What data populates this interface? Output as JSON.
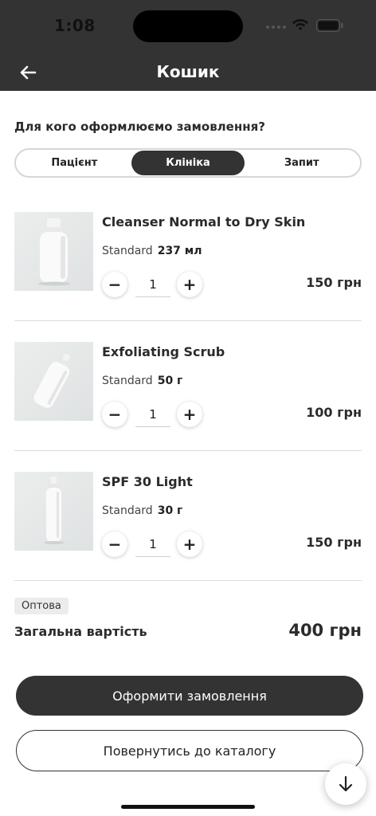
{
  "status_bar": {
    "time": "1:08"
  },
  "header": {
    "title": "Кошик"
  },
  "recipient": {
    "question": "Для кого оформлюємо замовлення?",
    "options": [
      "Пацієнт",
      "Клініка",
      "Запит"
    ],
    "selected": "Клініка"
  },
  "cart": {
    "items": [
      {
        "name": "Cleanser Normal to Dry Skin",
        "variant_label": "Standard",
        "size": "237 мл",
        "quantity": "1",
        "price": "150 грн"
      },
      {
        "name": "Exfoliating Scrub",
        "variant_label": "Standard",
        "size": "50 г",
        "quantity": "1",
        "price": "100 грн"
      },
      {
        "name": "SPF 30 Light",
        "variant_label": "Standard",
        "size": "30 г",
        "quantity": "1",
        "price": "150 грн"
      }
    ],
    "minus_symbol": "−",
    "plus_symbol": "+"
  },
  "summary": {
    "badge": "Оптова",
    "total_label": "Загальна вартість",
    "total_value": "400 грн"
  },
  "actions": {
    "checkout_label": "Оформити замовлення",
    "back_to_catalog_label": "Повернутись до каталогу"
  },
  "icons": {
    "back": "arrow-left-icon",
    "scroll_down": "arrow-down-icon",
    "wifi": "wifi-icon",
    "battery": "battery-icon"
  },
  "colors": {
    "header_bg": "#333333",
    "primary_button": "#333333",
    "divider": "#dcdcdc"
  }
}
